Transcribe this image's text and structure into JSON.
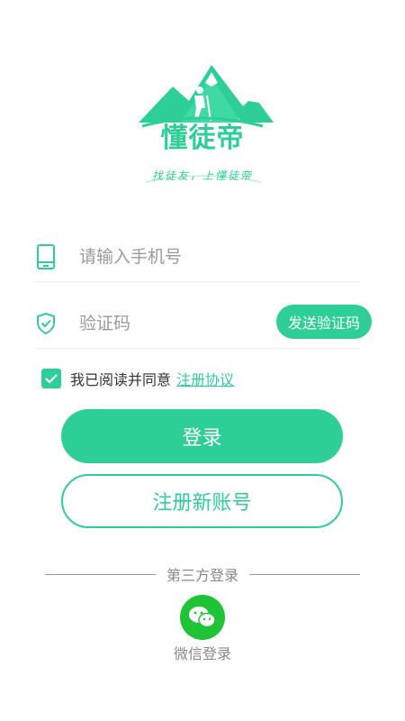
{
  "brand": {
    "name": "懂徒帝",
    "slogan": "找徒友，上懂徒帝",
    "color": "#2ecf97"
  },
  "form": {
    "phone": {
      "placeholder": "请输入手机号",
      "value": "",
      "icon": "phone-icon"
    },
    "code": {
      "placeholder": "验证码",
      "value": "",
      "icon": "shield-check-icon"
    },
    "send_code_label": "发送验证码"
  },
  "agreement": {
    "checked": true,
    "text": "我已阅读并同意",
    "link_text": "注册协议"
  },
  "buttons": {
    "login_label": "登录",
    "register_label": "注册新账号"
  },
  "third_party": {
    "divider_text": "第三方登录",
    "wechat_label": "微信登录",
    "wechat_color": "#1ec436"
  }
}
